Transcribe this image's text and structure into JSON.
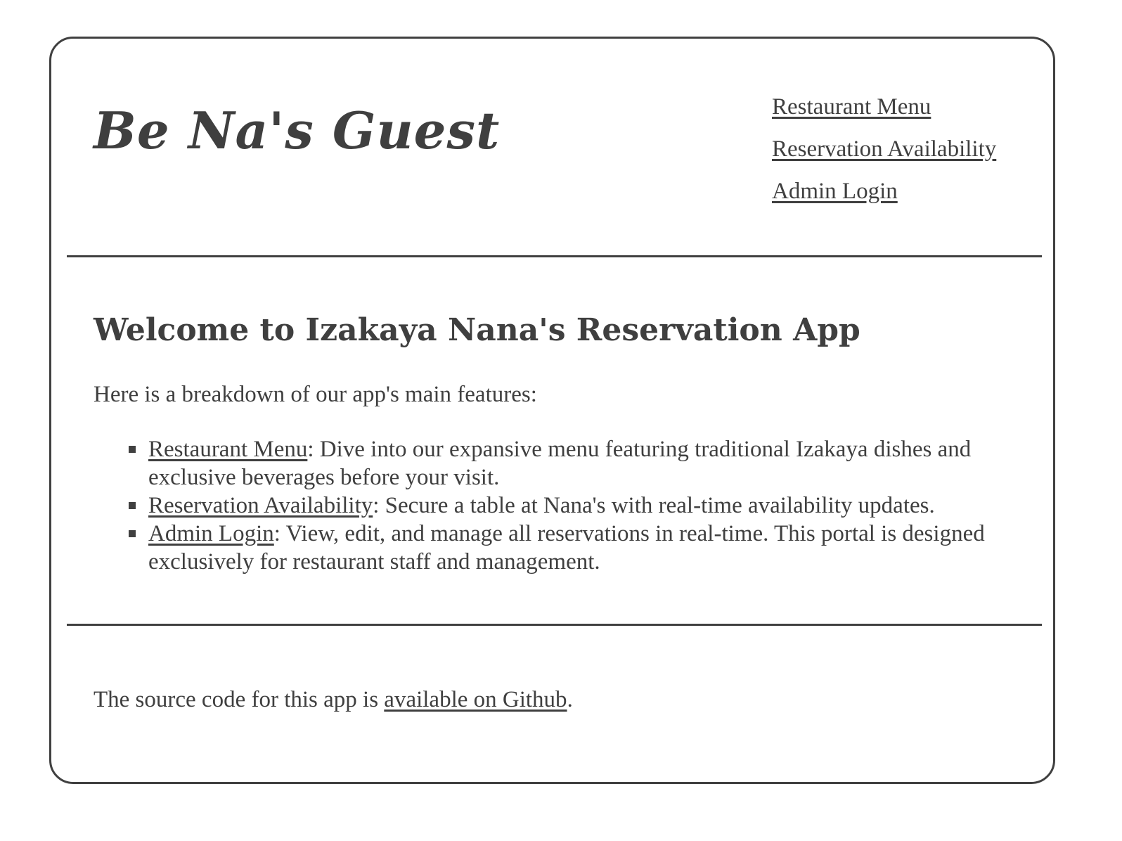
{
  "header": {
    "brand": "Be Na's Guest",
    "nav": [
      {
        "label": "Restaurant Menu"
      },
      {
        "label": "Reservation Availability"
      },
      {
        "label": "Admin Login"
      }
    ]
  },
  "main": {
    "title": "Welcome to Izakaya Nana's Reservation App",
    "intro": "Here is a breakdown of our app's main features:",
    "features": [
      {
        "link": "Restaurant Menu",
        "text": ": Dive into our expansive menu featuring traditional Izakaya dishes and exclusive beverages before your visit."
      },
      {
        "link": "Reservation Availability",
        "text": ": Secure a table at Nana's with real-time availability updates."
      },
      {
        "link": "Admin Login",
        "text": ": View, edit, and manage all reservations in real-time. This portal is designed exclusively for restaurant staff and management."
      }
    ]
  },
  "footer": {
    "prefix": "The source code for this app is ",
    "link": "available on Github",
    "suffix": "."
  },
  "colors": {
    "text": "#3f3f3f",
    "border": "#404040",
    "background": "#ffffff"
  }
}
